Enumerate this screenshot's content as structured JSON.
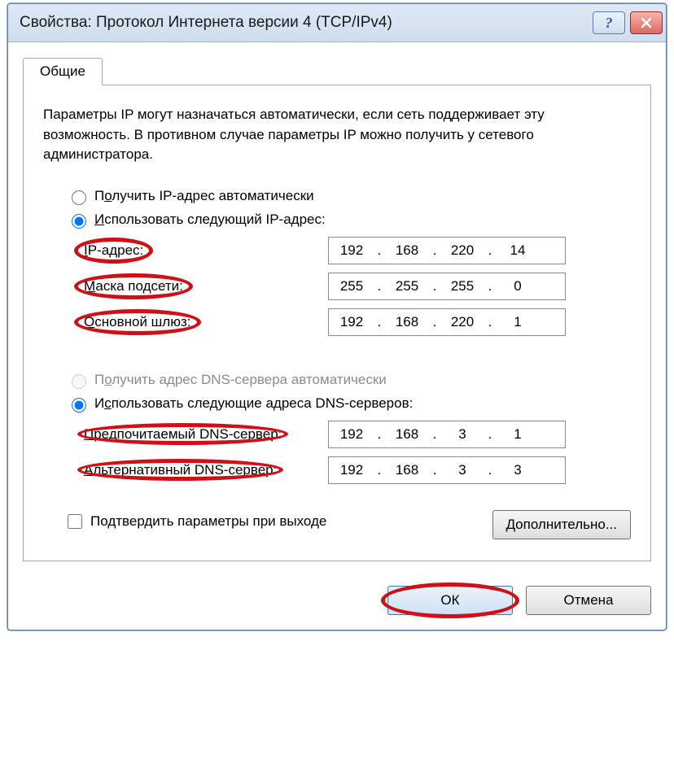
{
  "window": {
    "title": "Свойства: Протокол Интернета версии 4 (TCP/IPv4)"
  },
  "tab": {
    "label": "Общие"
  },
  "desc": "Параметры IP могут назначаться автоматически, если сеть поддерживает эту возможность. В противном случае параметры IP можно получить у сетевого администратора.",
  "ip_section": {
    "auto": {
      "label_pre": "П",
      "label_u": "о",
      "label_post": "лучить IP-адрес автоматически",
      "checked": false
    },
    "manual": {
      "label_pre": "",
      "label_u": "И",
      "label_post": "спользовать следующий IP-адрес:",
      "checked": true
    },
    "ip": {
      "label_pre": "",
      "label_u": "I",
      "label_post": "P-адрес:",
      "o1": "192",
      "o2": "168",
      "o3": "220",
      "o4": "14"
    },
    "mask": {
      "label_pre": "",
      "label_u": "М",
      "label_post": "аска подсети:",
      "o1": "255",
      "o2": "255",
      "o3": "255",
      "o4": "0"
    },
    "gateway": {
      "label_pre": "",
      "label_u": "О",
      "label_post": "сновной шлюз:",
      "o1": "192",
      "o2": "168",
      "o3": "220",
      "o4": "1"
    }
  },
  "dns_section": {
    "auto": {
      "label_pre": "П",
      "label_u": "о",
      "label_post": "лучить адрес DNS-сервера автоматически",
      "checked": false,
      "disabled": true
    },
    "manual": {
      "label_pre": "И",
      "label_u": "с",
      "label_post": "пользовать следующие адреса DNS-серверов:",
      "checked": true
    },
    "pref": {
      "label_pre": "",
      "label_u": "П",
      "label_post": "редпочитаемый DNS-сервер:",
      "o1": "192",
      "o2": "168",
      "o3": "3",
      "o4": "1"
    },
    "alt": {
      "label_pre": "",
      "label_u": "А",
      "label_post": "льтернативный DNS-сервер:",
      "o1": "192",
      "o2": "168",
      "o3": "3",
      "o4": "3"
    }
  },
  "confirm_on_exit": {
    "label_pre": "По",
    "label_u": "д",
    "label_post": "твердить параметры при выходе"
  },
  "buttons": {
    "advanced_pre": "",
    "advanced_u": "Д",
    "advanced_post": "ополнительно...",
    "ok": "ОК",
    "cancel": "Отмена"
  }
}
